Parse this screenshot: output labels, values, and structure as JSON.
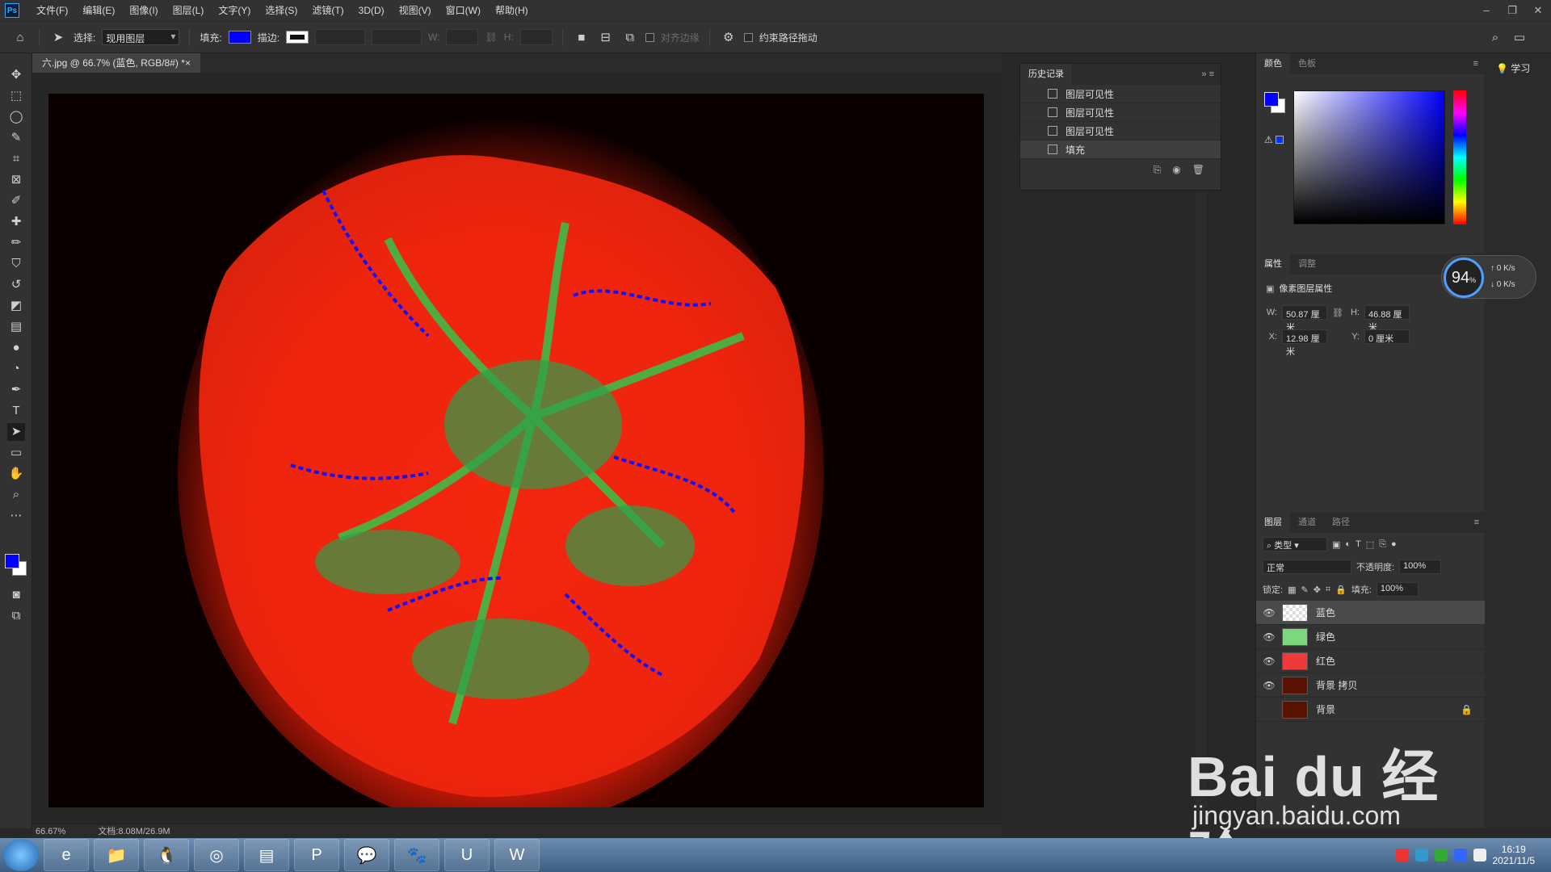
{
  "app": {
    "logo": "Ps"
  },
  "menu": [
    "文件(F)",
    "编辑(E)",
    "图像(I)",
    "图层(L)",
    "文字(Y)",
    "选择(S)",
    "滤镜(T)",
    "3D(D)",
    "视图(V)",
    "窗口(W)",
    "帮助(H)"
  ],
  "options": {
    "select_label": "选择:",
    "select_value": "现用图层",
    "fill_label": "填充:",
    "stroke_label": "描边:",
    "w_label": "W:",
    "h_label": "H:",
    "align_edges": "对齐边缘",
    "constrain_path": "约束路径拖动"
  },
  "document": {
    "tab_title": "六.jpg @ 66.7% (蓝色, RGB/8#) *",
    "zoom": "66.67%",
    "doc_size": "文档:8.08M/26.9M"
  },
  "history": {
    "tab": "历史记录",
    "items": [
      "图层可见性",
      "图层可见性",
      "图层可见性",
      "填充"
    ]
  },
  "color_panel": {
    "tabs": [
      "颜色",
      "色板"
    ]
  },
  "learn": {
    "label": "学习"
  },
  "properties": {
    "tabs": [
      "属性",
      "调整"
    ],
    "title": "像素图层属性",
    "w_label": "W:",
    "w": "50.87 厘米",
    "h_label": "H:",
    "h": "46.88 厘米",
    "x_label": "X:",
    "x": "12.98 厘米",
    "y_label": "Y:",
    "y": "0 厘米"
  },
  "speed": {
    "percent": "94",
    "percent_sign": "%",
    "up": "0 K/s",
    "down": "0 K/s"
  },
  "layers_panel": {
    "tabs": [
      "图层",
      "通道",
      "路径"
    ],
    "filter": "类型",
    "blend": "正常",
    "opacity_label": "不透明度:",
    "opacity": "100%",
    "lock_label": "锁定:",
    "fill_label": "填充:",
    "fill": "100%",
    "layers": [
      "蓝色",
      "绿色",
      "红色",
      "背景 拷贝",
      "背景"
    ]
  },
  "watermark": {
    "main": "Bai du 经验",
    "sub": "jingyan.baidu.com"
  },
  "taskbar": {
    "time": "16:19",
    "date": "2021/11/5"
  }
}
